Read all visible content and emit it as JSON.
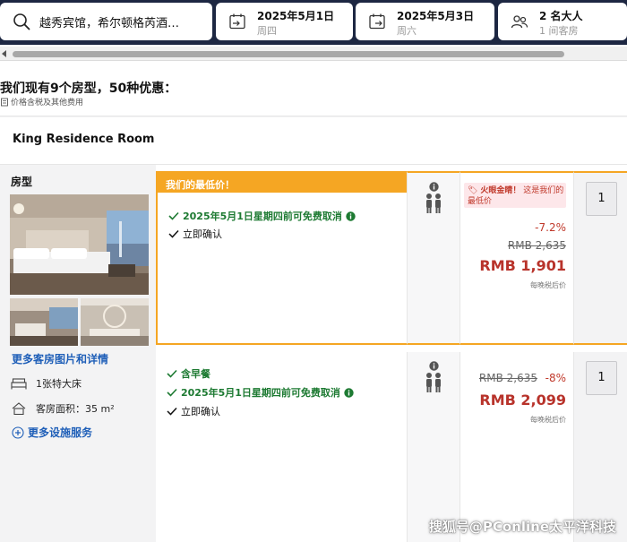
{
  "search": {
    "destination": "越秀宾馆，希尔顿格芮酒…",
    "checkin": {
      "date": "2025年5月1日",
      "weekday": "周四"
    },
    "checkout": {
      "date": "2025年5月3日",
      "weekday": "周六"
    },
    "guests": {
      "adults": "2 名大人",
      "rooms": "1 间客房"
    }
  },
  "offers": {
    "title": "我们现有9个房型，50种优惠：",
    "note": "价格含税及其他费用"
  },
  "room": {
    "name": "King Residence Room",
    "section_label": "房型",
    "more_details": "更多客房图片和详情",
    "bed": "1张特大床",
    "area": "客房面积：35 m²",
    "more_facilities": "更多设施服务"
  },
  "rates": [
    {
      "banner": "我们的最低价！",
      "perks": [
        {
          "text": "2025年5月1日星期四前可免费取消",
          "style": "green",
          "info": true
        },
        {
          "text": "立即确认",
          "style": "plain",
          "info": false
        }
      ],
      "deal_tag_bold": "火眼金睛！",
      "deal_tag_rest": "这是我们的最低价",
      "discount": "-7.2%",
      "old_price": "RMB 2,635",
      "price": "RMB 1,901",
      "per_night": "每晚税后价",
      "qty": "1"
    },
    {
      "perks": [
        {
          "text": "含早餐",
          "style": "green",
          "info": false
        },
        {
          "text": "2025年5月1日星期四前可免费取消",
          "style": "green",
          "info": true
        },
        {
          "text": "立即确认",
          "style": "plain",
          "info": false
        }
      ],
      "old_price": "RMB 2,635",
      "discount": "-8%",
      "price": "RMB 2,099",
      "per_night": "每晚税后价",
      "qty": "1"
    }
  ],
  "watermark": "搜狐号@PConline太平洋科技",
  "colors": {
    "navy": "#1d2742",
    "orange": "#f5a623",
    "green": "#1d7a32",
    "red": "#b8332b",
    "link": "#1f5fb8"
  },
  "icons": [
    "search-icon",
    "calendar-in-icon",
    "calendar-out-icon",
    "guests-icon",
    "info-icon",
    "occupancy-icon",
    "bed-icon",
    "house-icon",
    "plus-circle-icon",
    "check-icon",
    "receipt-icon"
  ]
}
